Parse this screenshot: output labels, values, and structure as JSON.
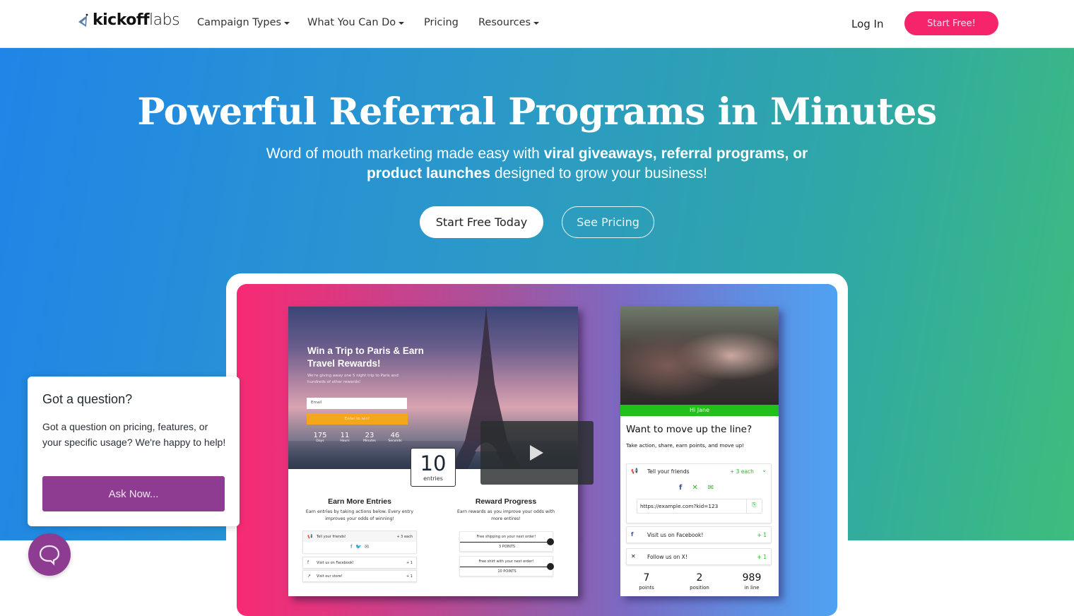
{
  "nav": {
    "logo_bold": "kickoff",
    "logo_light": "labs",
    "items": [
      {
        "label": "Campaign Types",
        "has_dropdown": true
      },
      {
        "label": "What You Can Do",
        "has_dropdown": true
      },
      {
        "label": "Pricing",
        "has_dropdown": false
      },
      {
        "label": "Resources",
        "has_dropdown": true
      }
    ],
    "login": "Log In",
    "cta": "Start Free!"
  },
  "hero": {
    "title": "Powerful Referral Programs in Minutes",
    "sub_1": "Word of mouth marketing made easy with ",
    "sub_bold": "viral giveaways, referral programs, or product launches",
    "sub_2": " designed to grow your business!",
    "primary_button": "Start Free Today",
    "secondary_button": "See Pricing"
  },
  "giveaway": {
    "heading": "Win a Trip to Paris & Earn Travel Rewards!",
    "text": "We're giving away one 5 night trip to Paris and hundreds of other rewards!",
    "email_placeholder": "Email",
    "enter_button": "Enter to win!",
    "countdown": [
      {
        "value": "175",
        "label": "Days"
      },
      {
        "value": "11",
        "label": "Hours"
      },
      {
        "value": "23",
        "label": "Minutes"
      },
      {
        "value": "46",
        "label": "Seconds"
      }
    ],
    "entries_value": "10",
    "entries_label": "entries",
    "earn": {
      "heading": "Earn More Entries",
      "text": "Earn entries by taking actions below. Every entry improves your odds of winning!",
      "actions": [
        {
          "label": "Tell your friends!",
          "points": "+ 3 each"
        },
        {
          "label": "Visit us on Facebook!",
          "points": "+ 1"
        },
        {
          "label": "Visit our store!",
          "points": "+ 1"
        }
      ]
    },
    "rewards": {
      "heading": "Reward Progress",
      "text": "Earn rewards as you improve your odds with more entires!",
      "items": [
        {
          "label": "Free shipping on your next order!",
          "points": "3 POINTS"
        },
        {
          "label": "Free shirt with your next order!",
          "points": "10 POINTS"
        }
      ]
    }
  },
  "waitlist": {
    "greeting": "Hi Jane",
    "heading": "Want to move up the line?",
    "text": "Take action, share, earn points, and move up!",
    "tell": {
      "label": "Tell your friends",
      "points": "+ 3 each"
    },
    "referral_url": "https://example.com?kid=123",
    "actions": [
      {
        "icon": "facebook-icon",
        "label": "Visit us on Facebook!",
        "points": "+ 1"
      },
      {
        "icon": "x-icon",
        "label": "Follow us on X!",
        "points": "+ 1"
      }
    ],
    "stats": [
      {
        "value": "7",
        "label": "points"
      },
      {
        "value": "2",
        "label": "position"
      },
      {
        "value": "989",
        "label": "in line"
      }
    ]
  },
  "chat": {
    "heading": "Got a question?",
    "text": "Got a question on pricing, features, or your specific usage? We're happy to help!",
    "button": "Ask Now..."
  },
  "colors": {
    "brand_pink": "#f5246b",
    "chat_purple": "#8e3c91",
    "waitlist_green": "#21c01b",
    "enter_orange": "#f5a71c"
  }
}
